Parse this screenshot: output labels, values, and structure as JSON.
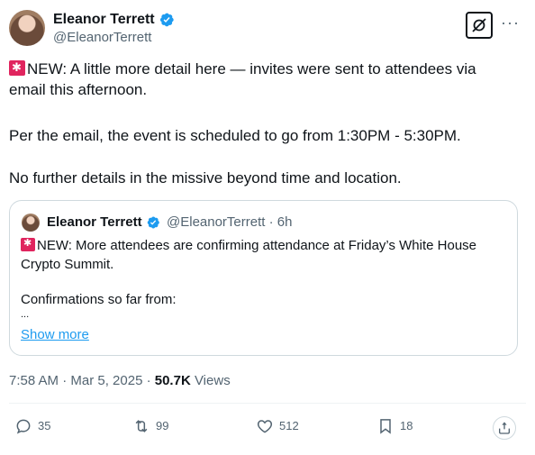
{
  "author": {
    "name": "Eleanor Terrett",
    "handle": "@EleanorTerrett"
  },
  "post": {
    "line1_prefix": "NEW: A little more detail here — invites were sent to attendees via",
    "line1_suffix": "email this afternoon.",
    "para2": "Per the email, the event is scheduled to go from 1:30PM - 5:30PM.",
    "para3": "No further details in the missive beyond time and location."
  },
  "quote": {
    "name": "Eleanor Terrett",
    "meta": "@EleanorTerrett · 6h",
    "line1": "NEW: More attendees are confirming attendance at Friday’s White House",
    "line2": "Crypto Summit.",
    "line3": "Confirmations so far from:",
    "line4": "...",
    "show_more": "Show more"
  },
  "timestamp": {
    "time_date": "7:58 AM · Mar 5, 2025 · ",
    "views_count": "50.7K",
    "views_label": " Views"
  },
  "actions": {
    "replies": "35",
    "reposts": "99",
    "likes": "512",
    "bookmarks": "18"
  },
  "colors": {
    "accent": "#1d9bf0",
    "text": "#0f1419",
    "muted": "#536471",
    "siren": "#e0245e"
  },
  "icons": [
    "verified-badge-icon",
    "grok-icon",
    "more-icon",
    "siren-emoji-icon",
    "reply-icon",
    "repost-icon",
    "like-icon",
    "bookmark-icon",
    "share-icon"
  ]
}
